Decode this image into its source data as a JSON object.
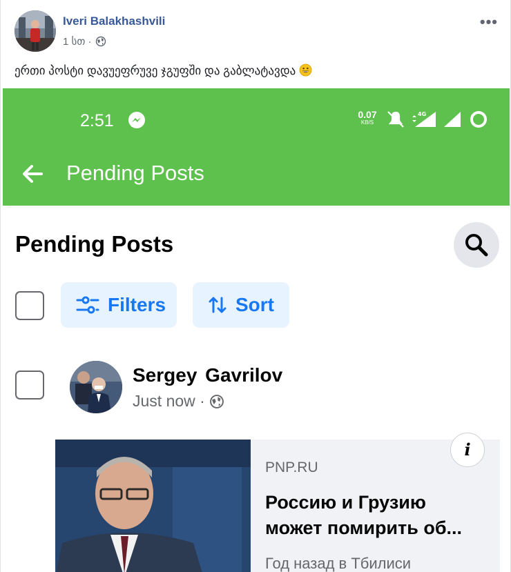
{
  "post": {
    "author": "Iveri Balakhashvili",
    "time": "1 სთ ·",
    "text": "ერთი პოსტი დავუეფრუვე ჯგუფში და გაბლატავდა",
    "emoji": "smiling-face-emoji"
  },
  "screenshot": {
    "status_bar": {
      "time": "2:51",
      "speed_value": "0.07",
      "speed_unit": "KB/S"
    },
    "app_bar": {
      "title": "Pending Posts"
    },
    "page": {
      "title": "Pending Posts",
      "filters_label": "Filters",
      "sort_label": "Sort"
    },
    "pending_post": {
      "author": "Sergey  Gavrilov",
      "time": "Just now ·",
      "link": {
        "domain": "PNP.RU",
        "title": "Россию и Грузию может помирить об...",
        "subtitle": "Год назад в Тбилиси",
        "info_label": "i"
      }
    }
  },
  "colors": {
    "accent_green": "#5ec04d",
    "facebook_blue": "#385898",
    "chip_blue": "#1877f2",
    "chip_bg": "#e7f3ff"
  }
}
